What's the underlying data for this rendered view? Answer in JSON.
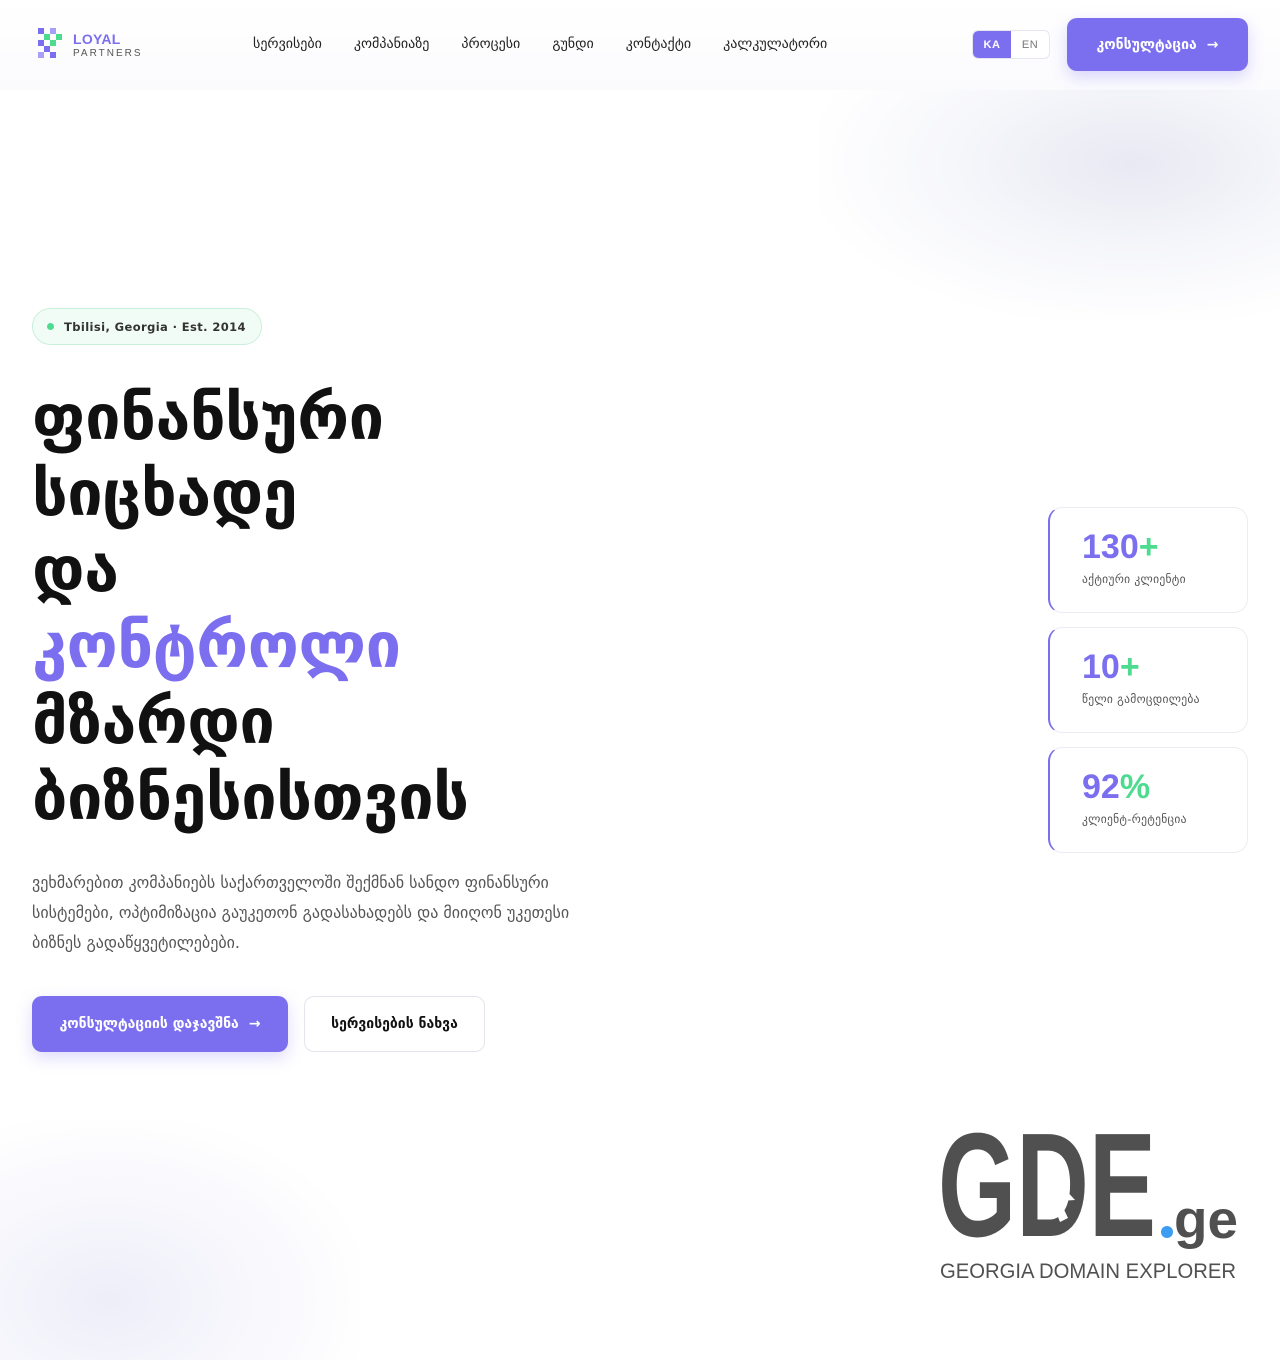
{
  "brand": {
    "name_line1": "LOYAL",
    "name_line2": "PARTNERS",
    "accent_color": "#7b6ff0",
    "green_color": "#4ddb8f"
  },
  "nav": {
    "items": [
      {
        "label": "სერვისები"
      },
      {
        "label": "კომპანიაზე"
      },
      {
        "label": "პროცესი"
      },
      {
        "label": "გუნდი"
      },
      {
        "label": "კონტაქტი"
      },
      {
        "label": "კალკულატორი"
      }
    ]
  },
  "language": {
    "options": [
      "KA",
      "EN"
    ],
    "selected": "KA"
  },
  "header_cta": {
    "label": "კონსულტაცია",
    "icon": "arrow-right-icon"
  },
  "hero": {
    "badge": "Tbilisi, Georgia · Est. 2014",
    "headline_lines": [
      "ფინანსური",
      "სიცხადე",
      "და",
      "კონტროლი",
      "მზარდი",
      "ბიზნესისთვის"
    ],
    "headline_accent_line": "კონტროლი",
    "lead": "ვეხმარებით კომპანიებს საქართველოში შექმნან სანდო ფინანსური სისტემები, ოპტიმიზაცია გაუკეთონ გადასახადებს და მიიღონ უკეთესი ბიზნეს გადაწყვეტილებები.",
    "primary_button": "კონსულტაციის დაჯავშნა",
    "secondary_button": "სერვისების ნახვა"
  },
  "stats": [
    {
      "value": "130",
      "suffix": "+",
      "label": "აქტიური კლიენტი"
    },
    {
      "value": "10",
      "suffix": "+",
      "label": "წელი გამოცდილება"
    },
    {
      "value": "92",
      "suffix": "%",
      "label": "კლიენტ-რეტენცია"
    }
  ],
  "watermark": {
    "logo_text": "GDE.ge",
    "tagline": "GEORGIA DOMAIN EXPLORER"
  }
}
